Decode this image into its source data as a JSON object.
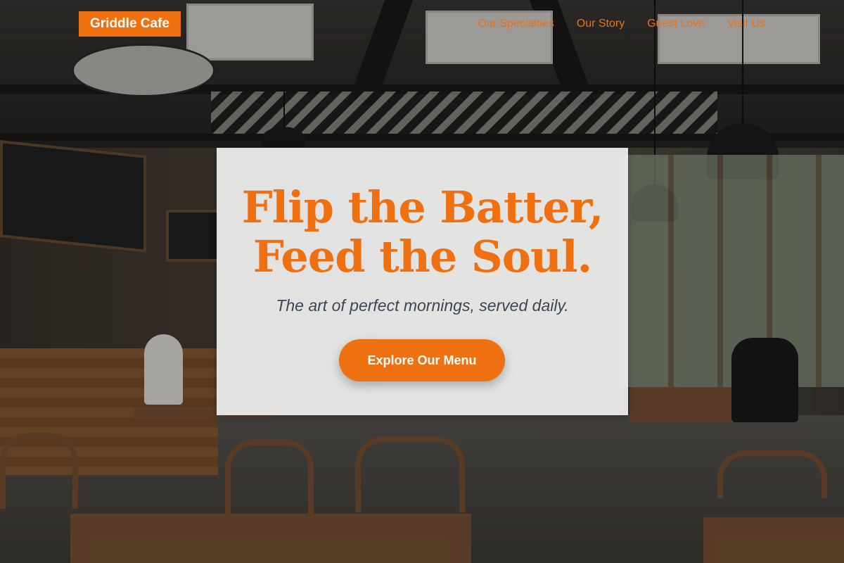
{
  "brand": {
    "logo_text": "Griddle Cafe",
    "accent_color": "#ee7011"
  },
  "nav": {
    "items": [
      {
        "label": "Our Specialties"
      },
      {
        "label": "Our Story"
      },
      {
        "label": "Guest Love"
      },
      {
        "label": "Visit Us"
      }
    ]
  },
  "hero": {
    "headline_line1": "Flip the Batter,",
    "headline_line2": "Feed the Soul.",
    "tagline": "The art of perfect mornings, served daily.",
    "cta_label": "Explore Our Menu"
  }
}
